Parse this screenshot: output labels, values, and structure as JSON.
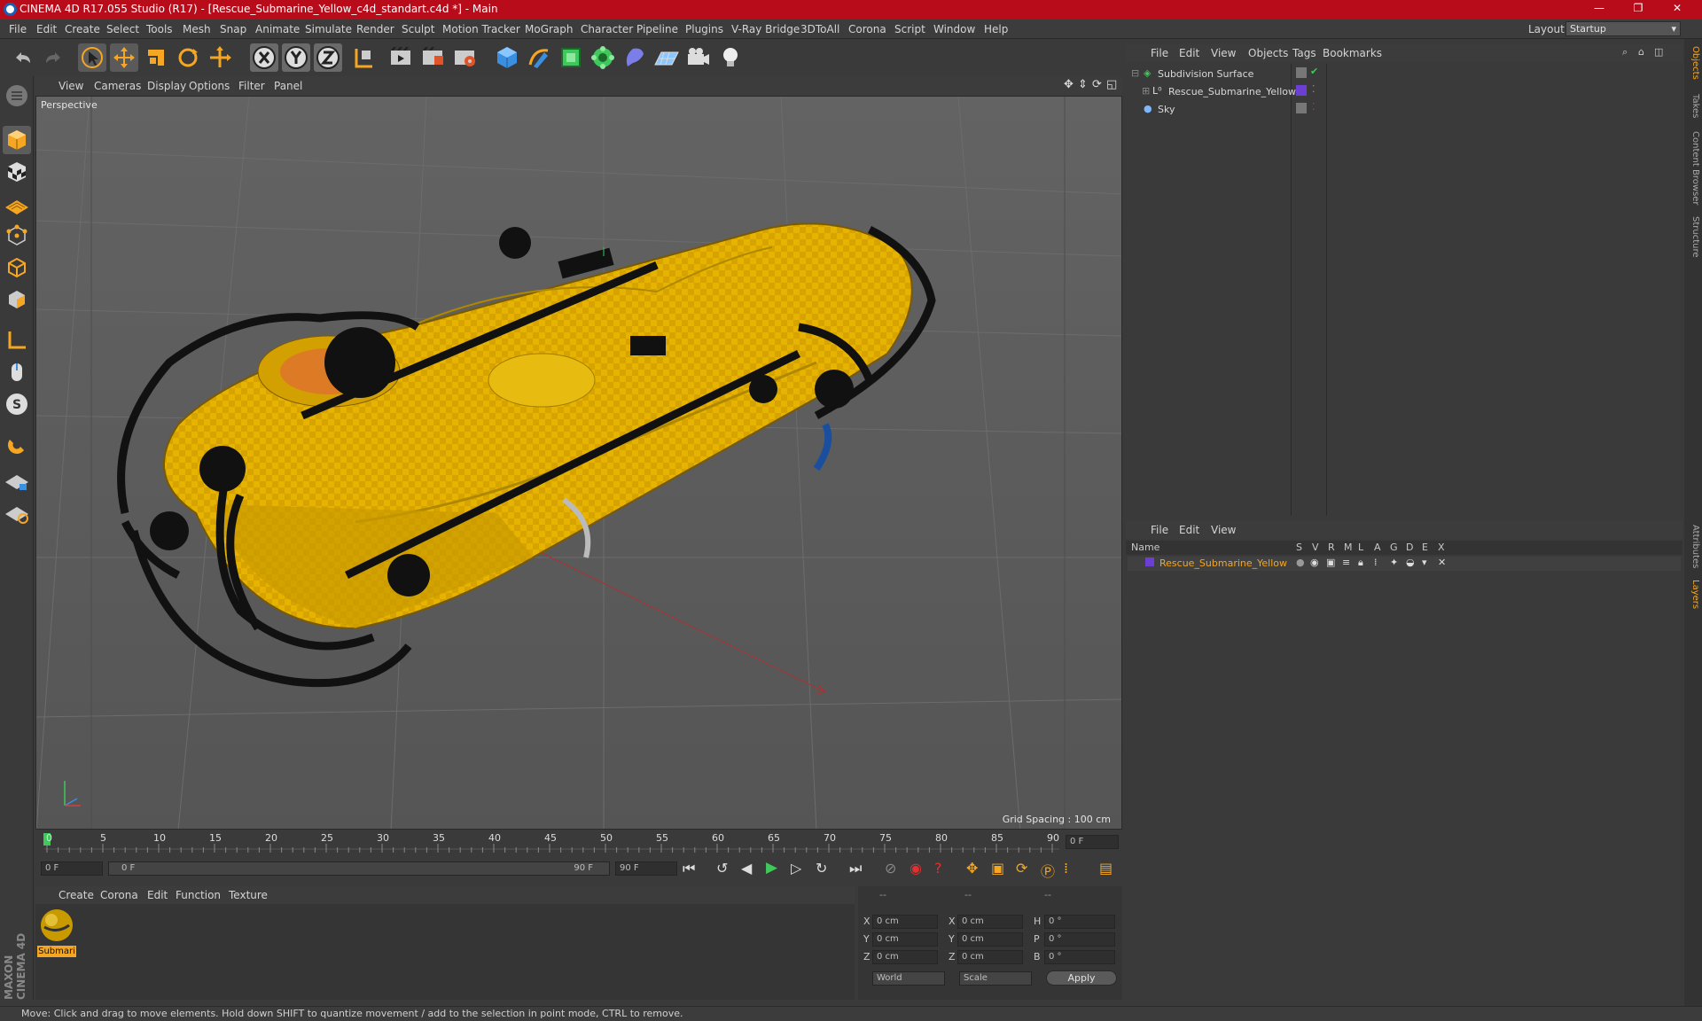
{
  "window": {
    "title": "CINEMA 4D R17.055 Studio (R17) - [Rescue_Submarine_Yellow_c4d_standart.c4d *] - Main",
    "min": "—",
    "max": "❐",
    "close": "✕"
  },
  "menu": [
    "File",
    "Edit",
    "Create",
    "Select",
    "Tools",
    "Mesh",
    "Snap",
    "Animate",
    "Simulate",
    "Render",
    "Sculpt",
    "Motion Tracker",
    "MoGraph",
    "Character",
    "Pipeline",
    "Plugins",
    "V-Ray Bridge",
    "3DToAll",
    "Corona",
    "Script",
    "Window",
    "Help"
  ],
  "layout": {
    "label": "Layout:",
    "value": "Startup"
  },
  "viewport": {
    "menu": [
      "View",
      "Cameras",
      "Display",
      "Options",
      "Filter",
      "Panel"
    ],
    "label": "Perspective",
    "grid_spacing": "Grid Spacing : 100 cm"
  },
  "timeline": {
    "ticks": [
      "0",
      "5",
      "10",
      "15",
      "20",
      "25",
      "30",
      "35",
      "40",
      "45",
      "50",
      "55",
      "60",
      "65",
      "70",
      "75",
      "80",
      "85",
      "90"
    ],
    "current_frame": "0 F",
    "start_field": "0 F",
    "range_left": "0 F",
    "range_right": "90 F",
    "end_field": "90 F"
  },
  "material_manager": {
    "menu": [
      "Create",
      "Corona",
      "Edit",
      "Function",
      "Texture"
    ],
    "material_label": "Submari"
  },
  "coordinates": {
    "headers": [
      "--",
      "--",
      "--"
    ],
    "rows": [
      {
        "a": "X",
        "av": "0 cm",
        "b": "X",
        "bv": "0 cm",
        "c": "H",
        "cv": "0 °"
      },
      {
        "a": "Y",
        "av": "0 cm",
        "b": "Y",
        "bv": "0 cm",
        "c": "P",
        "cv": "0 °"
      },
      {
        "a": "Z",
        "av": "0 cm",
        "b": "Z",
        "bv": "0 cm",
        "c": "B",
        "cv": "0 °"
      }
    ],
    "mode1": "World",
    "mode2": "Scale",
    "apply": "Apply"
  },
  "object_manager": {
    "menu": [
      "File",
      "Edit",
      "View",
      "Objects",
      "Tags",
      "Bookmarks"
    ],
    "objects": [
      {
        "name": "Subdivision Surface",
        "indent": 0
      },
      {
        "name": "Rescue_Submarine_Yellow",
        "indent": 1
      },
      {
        "name": "Sky",
        "indent": 0
      }
    ]
  },
  "layer_manager": {
    "menu": [
      "File",
      "Edit",
      "View"
    ],
    "columns": [
      "Name",
      "S",
      "V",
      "R",
      "M",
      "L",
      "A",
      "G",
      "D",
      "E",
      "X"
    ],
    "layer_name": "Rescue_Submarine_Yellow"
  },
  "right_tabs": [
    "Objects",
    "Takes",
    "Content Browser",
    "Structure",
    "Attributes",
    "Layers"
  ],
  "branding": "MAXON CINEMA 4D",
  "status": "Move: Click and drag to move elements. Hold down SHIFT to quantize movement / add to the selection in point mode, CTRL to remove.",
  "colors": {
    "titlebar": "#b80c1b",
    "accent": "#f5a623",
    "layer": "#6a3fd1",
    "submarine": "#e8b600"
  }
}
